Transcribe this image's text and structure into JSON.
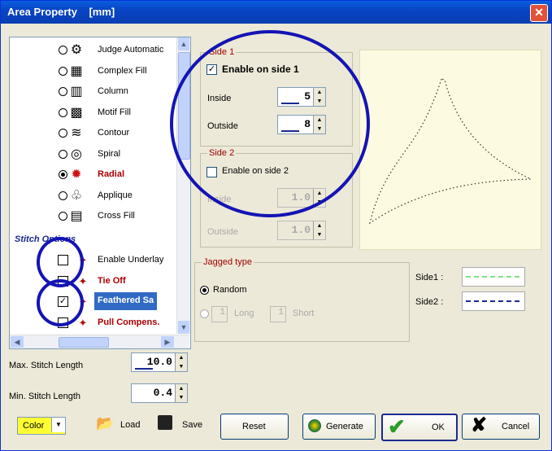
{
  "window": {
    "title": "Area Property",
    "unit": "[mm]",
    "close_symbol": "✕"
  },
  "fill_types": [
    {
      "label": "Judge Automatic",
      "selected": false,
      "icon": "judge-automatic-icon",
      "glyph": "⚙"
    },
    {
      "label": "Complex Fill",
      "selected": false,
      "icon": "complex-fill-icon",
      "glyph": "▦"
    },
    {
      "label": "Column",
      "selected": false,
      "icon": "column-icon",
      "glyph": "▥"
    },
    {
      "label": "Motif Fill",
      "selected": false,
      "icon": "motif-fill-icon",
      "glyph": "▩"
    },
    {
      "label": "Contour",
      "selected": false,
      "icon": "contour-icon",
      "glyph": "≋"
    },
    {
      "label": "Spiral",
      "selected": false,
      "icon": "spiral-icon",
      "glyph": "◎"
    },
    {
      "label": "Radial",
      "selected": true,
      "icon": "radial-icon",
      "glyph": "✹"
    },
    {
      "label": "Applique",
      "selected": false,
      "icon": "applique-icon",
      "glyph": "♧"
    },
    {
      "label": "Cross Fill",
      "selected": false,
      "icon": "cross-fill-icon",
      "glyph": "▤"
    }
  ],
  "stitch_options_header": "Stitch Options",
  "stitch_options": [
    {
      "label": "Enable Underlay",
      "checked": false,
      "bold": false
    },
    {
      "label": "Tie Off",
      "checked": false,
      "bold": true
    },
    {
      "label": "Feathered Sa",
      "checked": true,
      "bold": true,
      "highlighted": true
    },
    {
      "label": "Pull Compens.",
      "checked": false,
      "bold": true
    }
  ],
  "max_stitch": {
    "label": "Max. Stitch Length",
    "value": "10.0"
  },
  "min_stitch": {
    "label": "Min. Stitch Length",
    "value": "0.4"
  },
  "side1": {
    "legend": "Side 1",
    "enable_label": "Enable on side 1",
    "enabled": true,
    "inside_label": "Inside",
    "inside_value": "5",
    "outside_label": "Outside",
    "outside_value": "8"
  },
  "side2": {
    "legend": "Side 2",
    "enable_label": "Enable on side 2",
    "enabled": false,
    "inside_label": "Inside",
    "inside_value": "1.0",
    "outside_label": "Outside",
    "outside_value": "1.0"
  },
  "jagged": {
    "legend": "Jagged type",
    "random_label": "Random",
    "long_value": "1",
    "long_label": "Long",
    "short_value": "1",
    "short_label": "Short"
  },
  "legend_lines": [
    {
      "label": "Side1 :",
      "color": "#7ee07e"
    },
    {
      "label": "Side2 :",
      "color": "#1a2a90"
    }
  ],
  "bottom": {
    "color_label": "Color",
    "load_label": "Load",
    "save_label": "Save",
    "reset_label": "Reset",
    "generate_label": "Generate",
    "ok_label": "OK",
    "cancel_label": "Cancel"
  },
  "colors": {
    "accent": "#1414b4",
    "title_bar": "#0a5ddd",
    "selection": "#316ac5",
    "preview_bg": "#fcfae0"
  }
}
